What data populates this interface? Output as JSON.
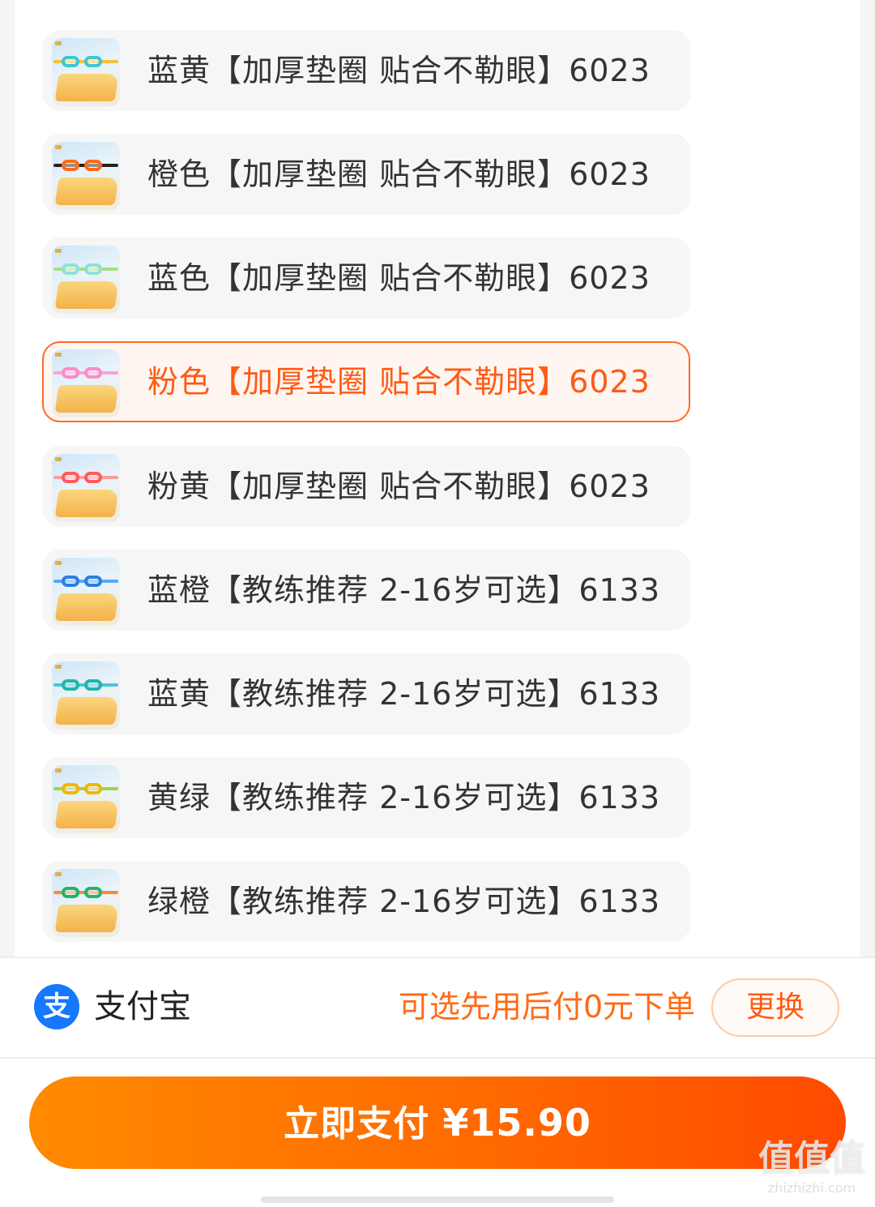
{
  "sku_options": [
    {
      "label": "蓝黄【加厚垫圈 贴合不勒眼】6023",
      "selected": false,
      "lens_color": "#3cc7d8",
      "strap_color": "#f2c23a"
    },
    {
      "label": "橙色【加厚垫圈 贴合不勒眼】6023",
      "selected": false,
      "lens_color": "#ff6a1a",
      "strap_color": "#222222"
    },
    {
      "label": "蓝色【加厚垫圈 贴合不勒眼】6023",
      "selected": false,
      "lens_color": "#8fe0d8",
      "strap_color": "#a7e07a"
    },
    {
      "label": "粉色【加厚垫圈 贴合不勒眼】6023",
      "selected": true,
      "lens_color": "#ff8ac8",
      "strap_color": "#f7a4d5"
    },
    {
      "label": "粉黄【加厚垫圈 贴合不勒眼】6023",
      "selected": false,
      "lens_color": "#ff5a5a",
      "strap_color": "#f5a0a0"
    },
    {
      "label": "蓝橙【教练推荐 2-16岁可选】6133",
      "selected": false,
      "lens_color": "#2f7de0",
      "strap_color": "#5aa8f0"
    },
    {
      "label": "蓝黄【教练推荐 2-16岁可选】6133",
      "selected": false,
      "lens_color": "#1fb6a8",
      "strap_color": "#46c6d6"
    },
    {
      "label": "黄绿【教练推荐 2-16岁可选】6133",
      "selected": false,
      "lens_color": "#f5b400",
      "strap_color": "#9bd64a"
    },
    {
      "label": "绿橙【教练推荐 2-16岁可选】6133",
      "selected": false,
      "lens_color": "#23b36b",
      "strap_color": "#ff8a2a"
    }
  ],
  "payment": {
    "method_icon_glyph": "支",
    "method_name": "支付宝",
    "promo_text": "可选先用后付0元下单",
    "change_label": "更换"
  },
  "pay_button": {
    "label": "立即支付",
    "price": "¥15.90"
  },
  "watermark": {
    "main": "值值值",
    "url": "zhizhizhi.com"
  },
  "colors": {
    "accent": "#ff5a13",
    "selected_bg": "#fff6f1",
    "alipay_blue": "#1677ff"
  }
}
